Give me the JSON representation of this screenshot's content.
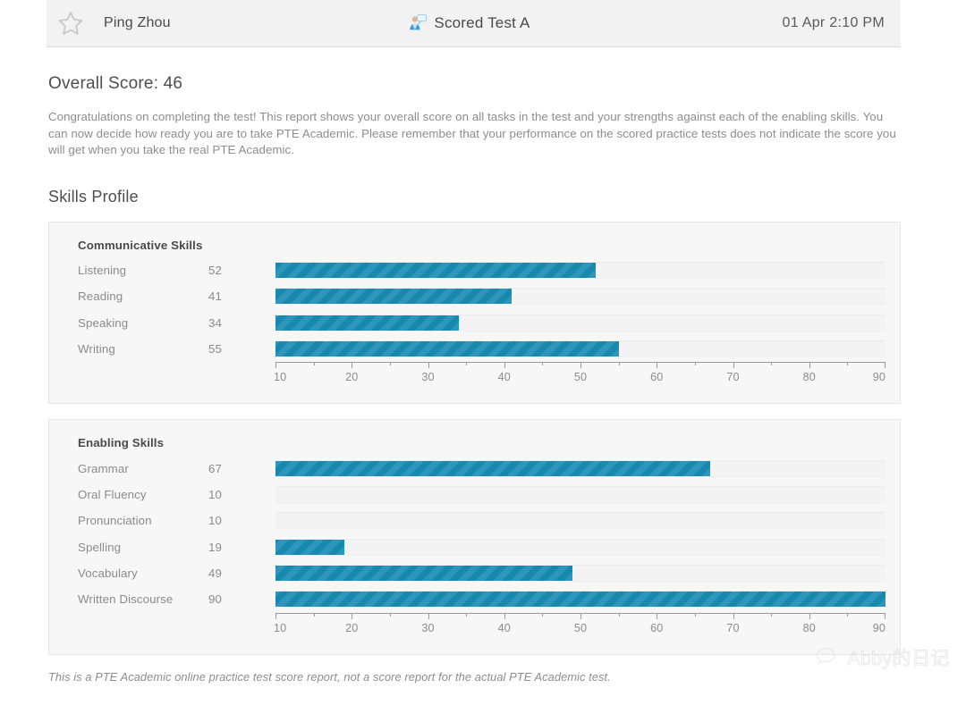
{
  "header": {
    "favorite_icon": "star-outline-icon",
    "user_name": "Ping Zhou",
    "test_icon": "person-speech-bubble-icon",
    "test_name": "Scored Test A",
    "timestamp": "01 Apr 2:10 PM"
  },
  "report": {
    "overall_score_label": "Overall Score: 46",
    "intro_paragraph": "Congratulations on completing the test! This report shows your overall score on all tasks in the test and your strengths against each of the enabling skills. You can now decide how ready you are to take PTE Academic. Please remember that your performance on the scored practice tests does not indicate the score you will get when you take the real PTE Academic.",
    "section_title": "Skills Profile",
    "footer_note": "This is a PTE Academic online practice test score report, not a score report for the actual PTE Academic test."
  },
  "watermark": {
    "icon": "wechat-icon",
    "text": "Abby的日记"
  },
  "colors": {
    "bar_light": "#2e96bb",
    "bar_dark": "#1788ae",
    "panel_bg": "#f7f7f7",
    "track_bg": "#f3f3f3",
    "header_bg": "#f2f2f2"
  },
  "chart_data": [
    {
      "type": "bar",
      "title": "Communicative Skills",
      "orientation": "horizontal",
      "categories": [
        "Listening",
        "Reading",
        "Speaking",
        "Writing"
      ],
      "values": [
        52,
        41,
        34,
        55
      ],
      "xlabel": "",
      "ylabel": "",
      "xlim": [
        10,
        90
      ],
      "ticks": [
        10,
        20,
        30,
        40,
        50,
        60,
        70,
        80,
        90
      ],
      "minor_ticks": [
        15,
        25,
        35,
        45,
        55,
        65,
        75,
        85
      ],
      "grid": false,
      "legend": "none"
    },
    {
      "type": "bar",
      "title": "Enabling Skills",
      "orientation": "horizontal",
      "categories": [
        "Grammar",
        "Oral Fluency",
        "Pronunciation",
        "Spelling",
        "Vocabulary",
        "Written Discourse"
      ],
      "values": [
        67,
        10,
        10,
        19,
        49,
        90
      ],
      "xlabel": "",
      "ylabel": "",
      "xlim": [
        10,
        90
      ],
      "ticks": [
        10,
        20,
        30,
        40,
        50,
        60,
        70,
        80,
        90
      ],
      "minor_ticks": [
        15,
        25,
        35,
        45,
        55,
        65,
        75,
        85
      ],
      "grid": false,
      "legend": "none"
    }
  ]
}
